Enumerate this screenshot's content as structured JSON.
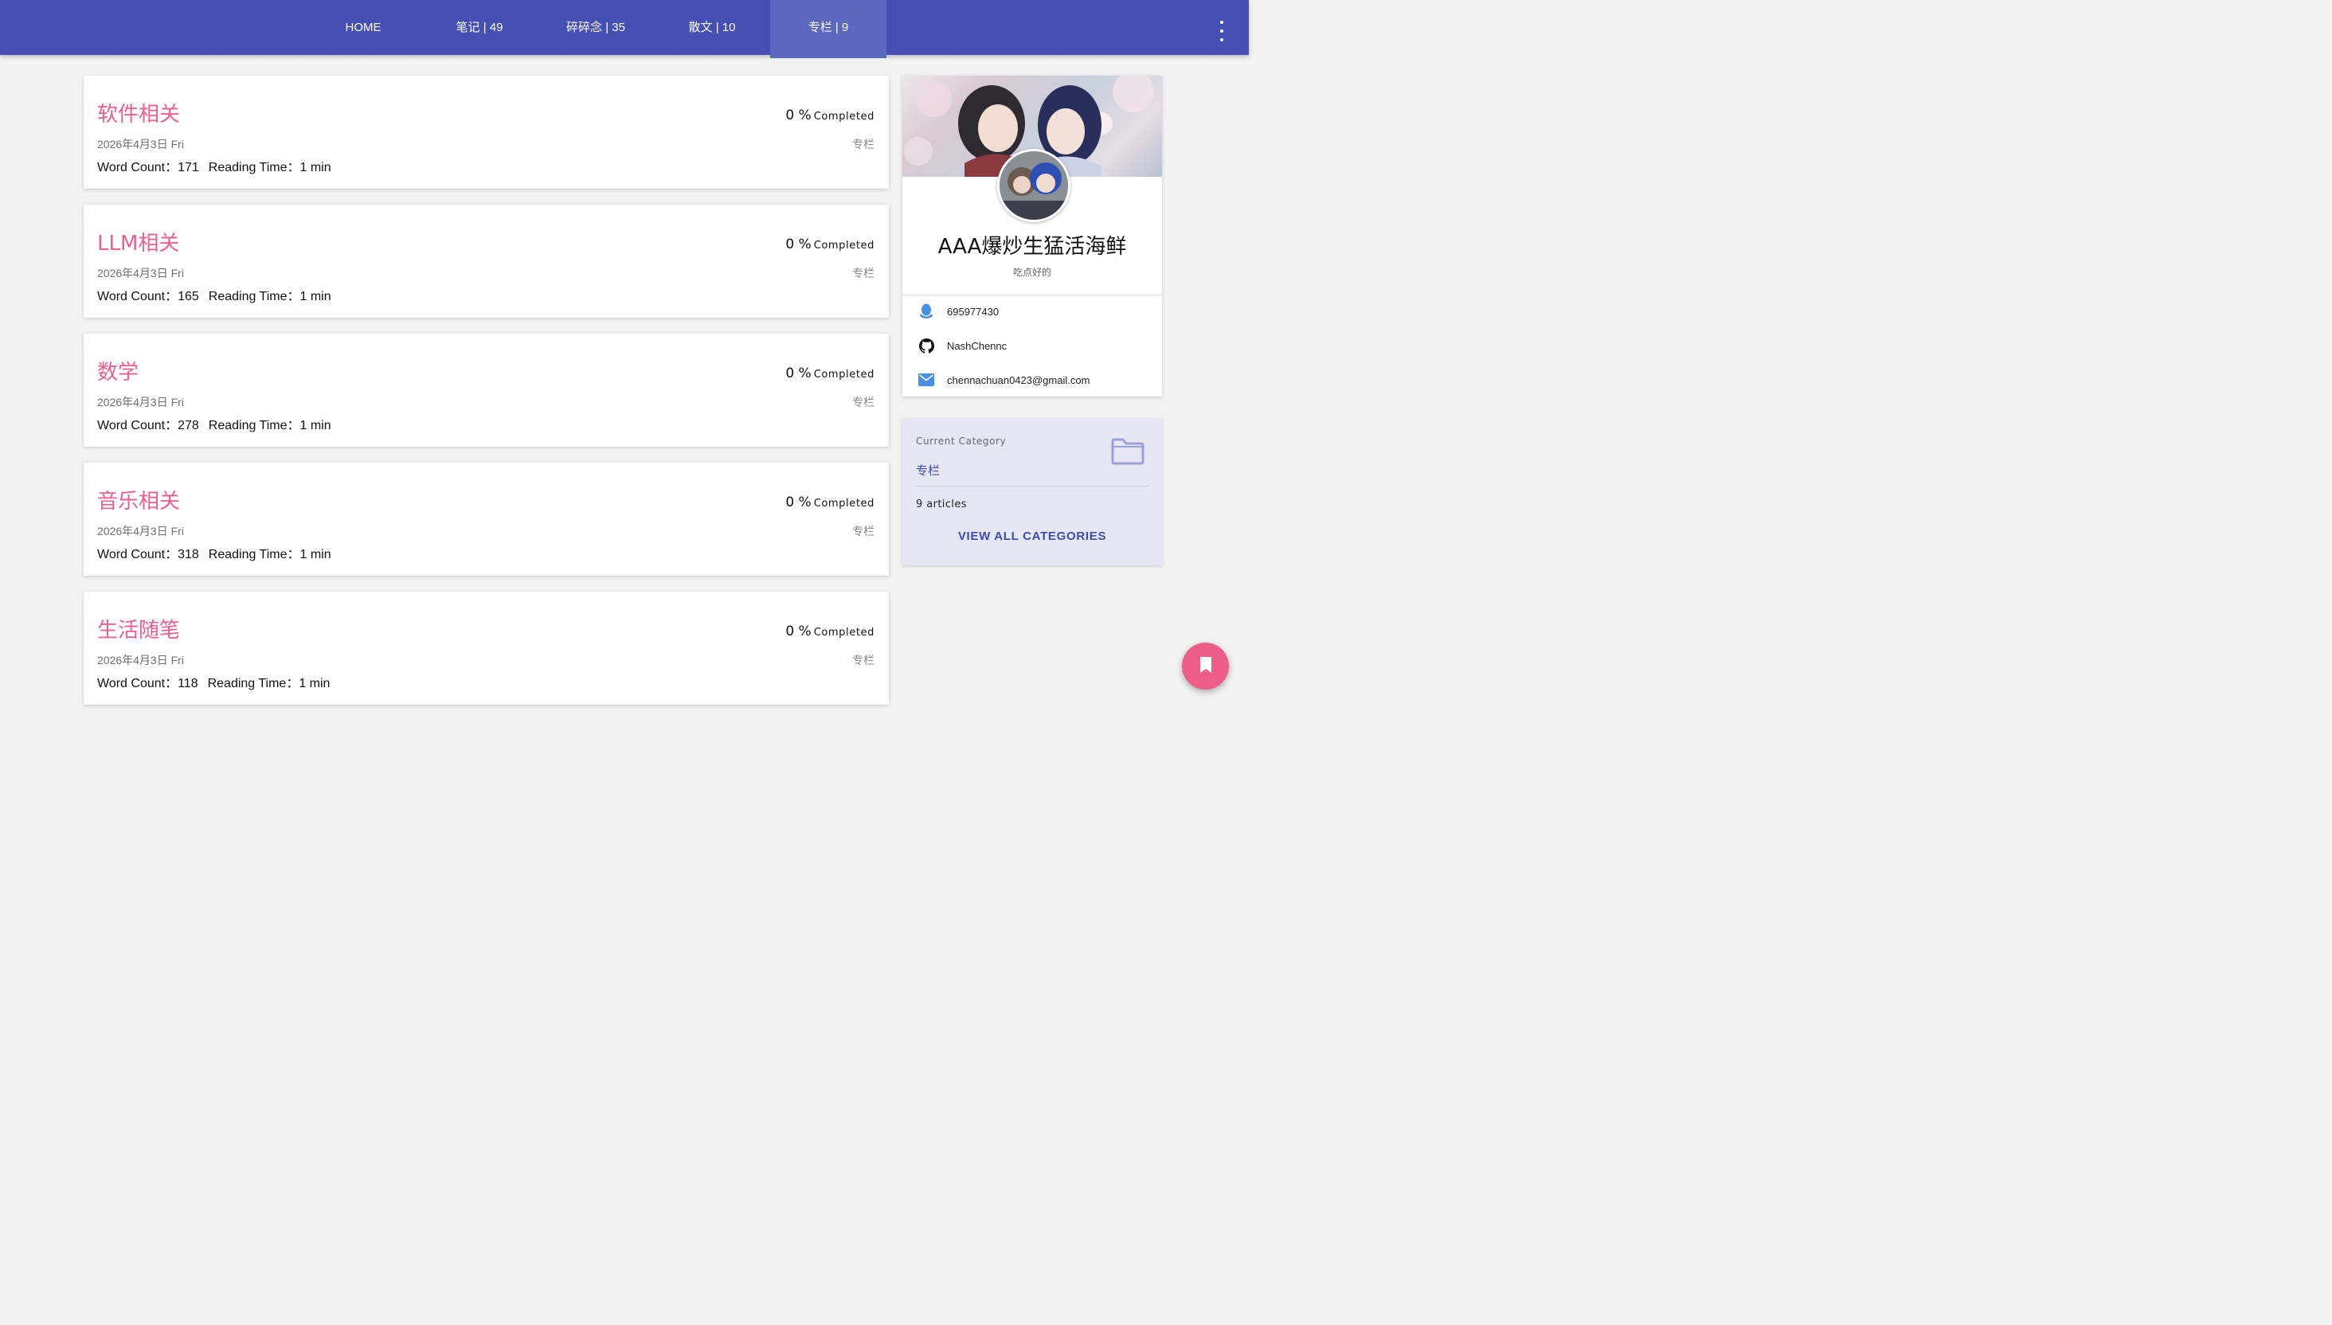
{
  "nav": {
    "tabs": [
      {
        "label": "HOME"
      },
      {
        "label": "笔记 | 49"
      },
      {
        "label": "碎碎念 | 35"
      },
      {
        "label": "散文 | 10"
      },
      {
        "label": "专栏 | 9"
      }
    ],
    "more_icon": "more-vert-icon"
  },
  "posts": [
    {
      "title": "软件相关",
      "date": "2026年4月3日 Fri",
      "word_count": "Word Count：171",
      "reading_time": "Reading Time：1 min",
      "progress": "0 %",
      "completed_label": "Completed",
      "category": "专栏"
    },
    {
      "title": "LLM相关",
      "date": "2026年4月3日 Fri",
      "word_count": "Word Count：165",
      "reading_time": "Reading Time：1 min",
      "progress": "0 %",
      "completed_label": "Completed",
      "category": "专栏"
    },
    {
      "title": "数学",
      "date": "2026年4月3日 Fri",
      "word_count": "Word Count：278",
      "reading_time": "Reading Time：1 min",
      "progress": "0 %",
      "completed_label": "Completed",
      "category": "专栏"
    },
    {
      "title": "音乐相关",
      "date": "2026年4月3日 Fri",
      "word_count": "Word Count：318",
      "reading_time": "Reading Time：1 min",
      "progress": "0 %",
      "completed_label": "Completed",
      "category": "专栏"
    },
    {
      "title": "生活随笔",
      "date": "2026年4月3日 Fri",
      "word_count": "Word Count：118",
      "reading_time": "Reading Time：1 min",
      "progress": "0 %",
      "completed_label": "Completed",
      "category": "专栏"
    }
  ],
  "profile": {
    "name": "AAA爆炒生猛活海鲜",
    "motto": "吃点好的",
    "contacts": [
      {
        "icon": "qq-icon",
        "text": "695977430"
      },
      {
        "icon": "github-icon",
        "text": "NashChennc"
      },
      {
        "icon": "mail-icon",
        "text": "chennachuan0423@gmail.com"
      }
    ]
  },
  "category_card": {
    "label": "Current Category",
    "name": "专栏",
    "count": "9 articles",
    "view_all": "VIEW ALL CATEGORIES",
    "icon": "folder-icon"
  },
  "fab": {
    "icon": "bookmark-icon"
  },
  "colors": {
    "primary": "#4650b4",
    "primary_active": "#5c67c0",
    "accent": "#e9618c",
    "fab": "#ec5e87",
    "category_bg": "#e6e7f5",
    "link": "#3f4bb0"
  }
}
